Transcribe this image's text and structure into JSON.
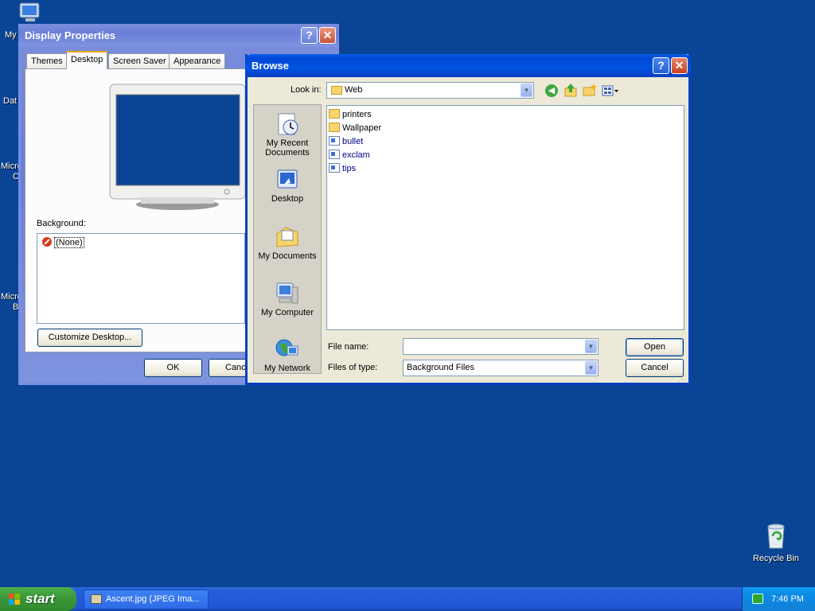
{
  "desktop": {
    "left_labels": [
      "My",
      "Dat",
      "Micro",
      "C",
      "Micro",
      "B"
    ],
    "recycle_bin": "Recycle Bin"
  },
  "display_properties": {
    "title": "Display Properties",
    "tabs": [
      "Themes",
      "Desktop",
      "Screen Saver",
      "Appearance"
    ],
    "background_label": "Background:",
    "background_items": [
      "(None)"
    ],
    "customize_button": "Customize Desktop...",
    "ok_button": "OK",
    "cancel_button": "Canc"
  },
  "browse": {
    "title": "Browse",
    "look_in_label": "Look in:",
    "look_in_value": "Web",
    "places": [
      "My Recent Documents",
      "Desktop",
      "My Documents",
      "My Computer",
      "My Network"
    ],
    "files": [
      {
        "name": "printers",
        "type": "folder"
      },
      {
        "name": "Wallpaper",
        "type": "folder"
      },
      {
        "name": "bullet",
        "type": "file"
      },
      {
        "name": "exclam",
        "type": "file"
      },
      {
        "name": "tips",
        "type": "file"
      }
    ],
    "file_name_label": "File name:",
    "file_name_value": "",
    "files_of_type_label": "Files of type:",
    "files_of_type_value": "Background Files",
    "open_button": "Open",
    "cancel_button": "Cancel"
  },
  "taskbar": {
    "start_label": "start",
    "task_item": "Ascent.jpg (JPEG Ima...",
    "clock": "7:46 PM"
  },
  "colors": {
    "desktop": "#0a4595",
    "title_active": "#0054e3",
    "title_inactive": "#7a8ee0",
    "start_green": "#3c9a3a"
  }
}
